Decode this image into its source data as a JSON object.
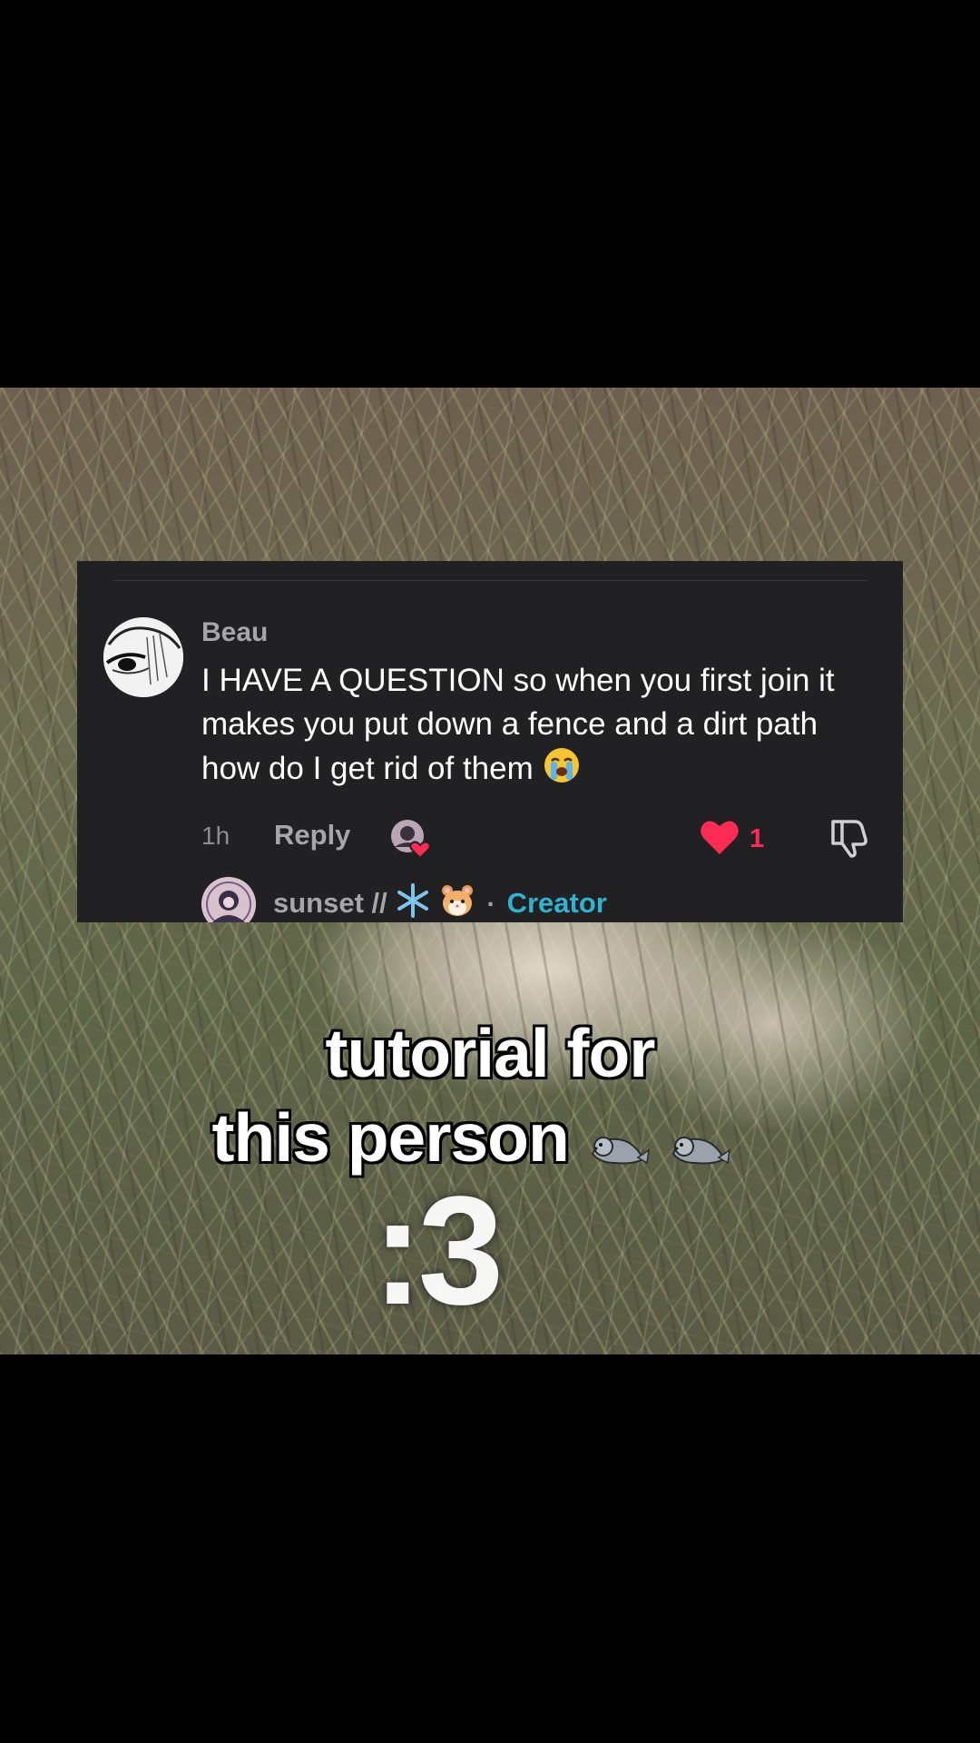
{
  "comment": {
    "username": "Beau",
    "text": "I HAVE A QUESTION so when you first join it makes you put down a fence and a dirt path how do I get rid of them",
    "emoji_icon": "loudly-crying-face-emoji",
    "time": "1h",
    "reply_label": "Reply",
    "like_count": "1",
    "like_color": "#fe2c55"
  },
  "reply": {
    "username": "sunset //",
    "emoji_icons": [
      "snowflake-emoji",
      "hamster-emoji"
    ],
    "separator": "·",
    "badge": "Creator",
    "badge_color": "#2fb4d0"
  },
  "caption": {
    "line1": "tutorial for",
    "line2": "this person",
    "emoji_icons": [
      "seal-emoji",
      "seal-emoji"
    ]
  },
  "overlay_text": ":3"
}
